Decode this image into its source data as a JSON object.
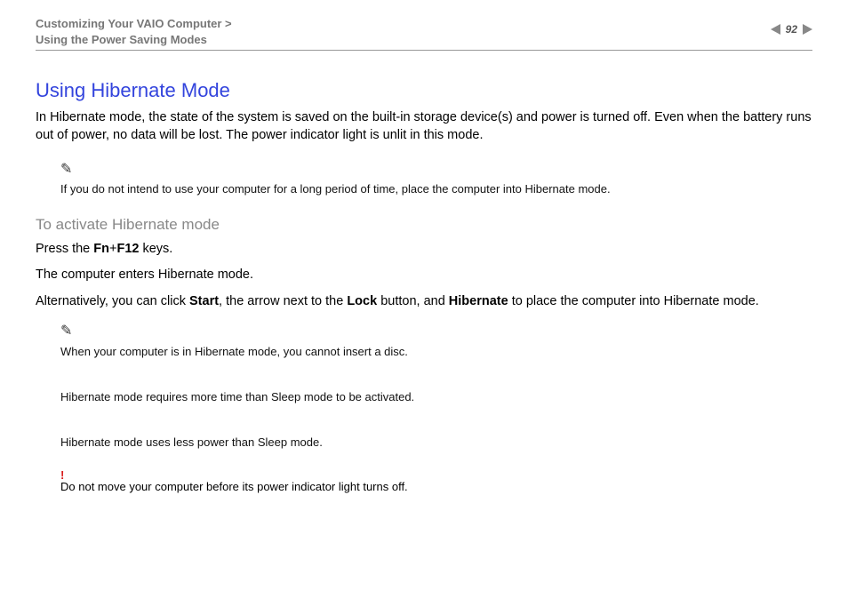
{
  "header": {
    "breadcrumb_line1": "Customizing Your VAIO Computer >",
    "breadcrumb_line2": "Using the Power Saving Modes",
    "page_number": "92"
  },
  "title": "Using Hibernate Mode",
  "intro": "In Hibernate mode, the state of the system is saved on the built-in storage device(s) and power is turned off. Even when the battery runs out of power, no data will be lost. The power indicator light is unlit in this mode.",
  "tip1": "If you do not intend to use your computer for a long period of time, place the computer into Hibernate mode.",
  "subhead": "To activate Hibernate mode",
  "press_prefix": "Press the ",
  "press_keys": "Fn",
  "press_mid": "+",
  "press_keys2": "F12",
  "press_suffix": " keys.",
  "enters": "The computer enters Hibernate mode.",
  "alt_prefix": "Alternatively, you can click ",
  "alt_start": "Start",
  "alt_mid1": ", the arrow next to the ",
  "alt_lock": "Lock",
  "alt_mid2": " button, and ",
  "alt_hib": "Hibernate",
  "alt_suffix": " to place the computer into Hibernate mode.",
  "tip2_a": "When your computer is in Hibernate mode, you cannot insert a disc.",
  "tip2_b": "Hibernate mode requires more time than Sleep mode to be activated.",
  "tip2_c": "Hibernate mode uses less power than Sleep mode.",
  "warn": "Do not move your computer before its power indicator light turns off."
}
